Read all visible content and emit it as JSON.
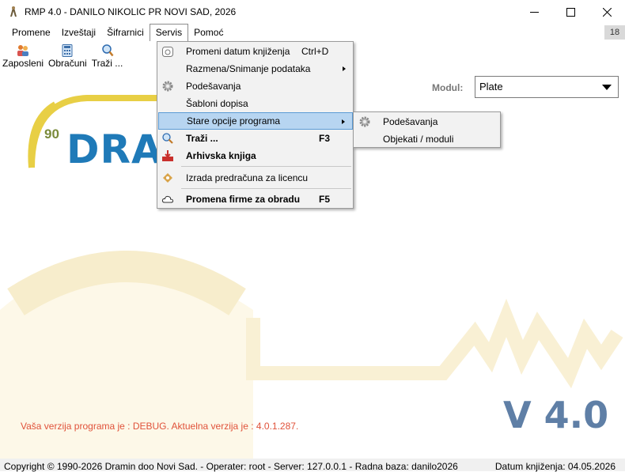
{
  "window": {
    "title": "RMP 4.0 - DANILO NIKOLIC PR NOVI SAD, 2026",
    "icons": [
      "app-icon",
      "minimize-icon",
      "maximize-icon",
      "close-icon"
    ]
  },
  "menubar": {
    "items": [
      {
        "label": "Promene"
      },
      {
        "label": "Izveštaji"
      },
      {
        "label": "Šifrarnici"
      },
      {
        "label": "Servis"
      },
      {
        "label": "Pomoć"
      }
    ],
    "active": "Servis",
    "badge": "18"
  },
  "toolbar": {
    "buttons": [
      {
        "label": "Zaposleni",
        "icon": "people-icon"
      },
      {
        "label": "Obračuni",
        "icon": "calculator-icon"
      },
      {
        "label": "Traži ...",
        "icon": "search-icon"
      }
    ]
  },
  "modul": {
    "label": "Modul:",
    "value": "Plate"
  },
  "servis_menu": {
    "items": [
      {
        "label": "Promeni datum knjiženja",
        "shortcut": "Ctrl+D",
        "icon": "calendar-icon"
      },
      {
        "label": "Razmena/Snimanje podataka",
        "shortcut": "",
        "icon": ""
      },
      {
        "label": "Podešavanja",
        "shortcut": "",
        "icon": "gear-icon"
      },
      {
        "label": "Šabloni dopisa",
        "shortcut": "",
        "icon": ""
      },
      {
        "label": "Stare opcije programa",
        "shortcut": "",
        "icon": ""
      },
      {
        "label": "Traži ...",
        "shortcut": "F3",
        "icon": "search-icon"
      },
      {
        "label": "Arhivska knjiga",
        "shortcut": "",
        "icon": "archive-icon"
      },
      {
        "label": "Izrada predračuna za licencu",
        "shortcut": "",
        "icon": "license-icon"
      },
      {
        "label": "Promena firme za obradu",
        "shortcut": "F5",
        "icon": "cloud-icon"
      }
    ],
    "highlighted": "Stare opcije programa"
  },
  "submenu": {
    "items": [
      {
        "label": "Podešavanja",
        "icon": "gear-icon"
      },
      {
        "label": "Objekati / moduli",
        "icon": ""
      }
    ]
  },
  "background": {
    "logo_badge": "90",
    "logo_text": "DRAMIN",
    "version_message": "Vaša verzija programa je : DEBUG. Aktuelna verzija je : 4.0.1.287.",
    "version_big": "V 4.0"
  },
  "statusbar": {
    "left": "Copyright © 1990-2026 Dramin doo Novi Sad. - Operater: root - Server: 127.0.0.1 - Radna baza: danilo2026",
    "right": "Datum knjiženja: 04.05.2026"
  },
  "colors": {
    "accent_highlight": "#b7d5f1",
    "highlight_border": "#5b9bd5",
    "logo_blue": "#1f7ab8",
    "logo_yellow": "#e8cf45",
    "version_blue": "#5f7fa6",
    "warning_text": "#e0523a"
  }
}
